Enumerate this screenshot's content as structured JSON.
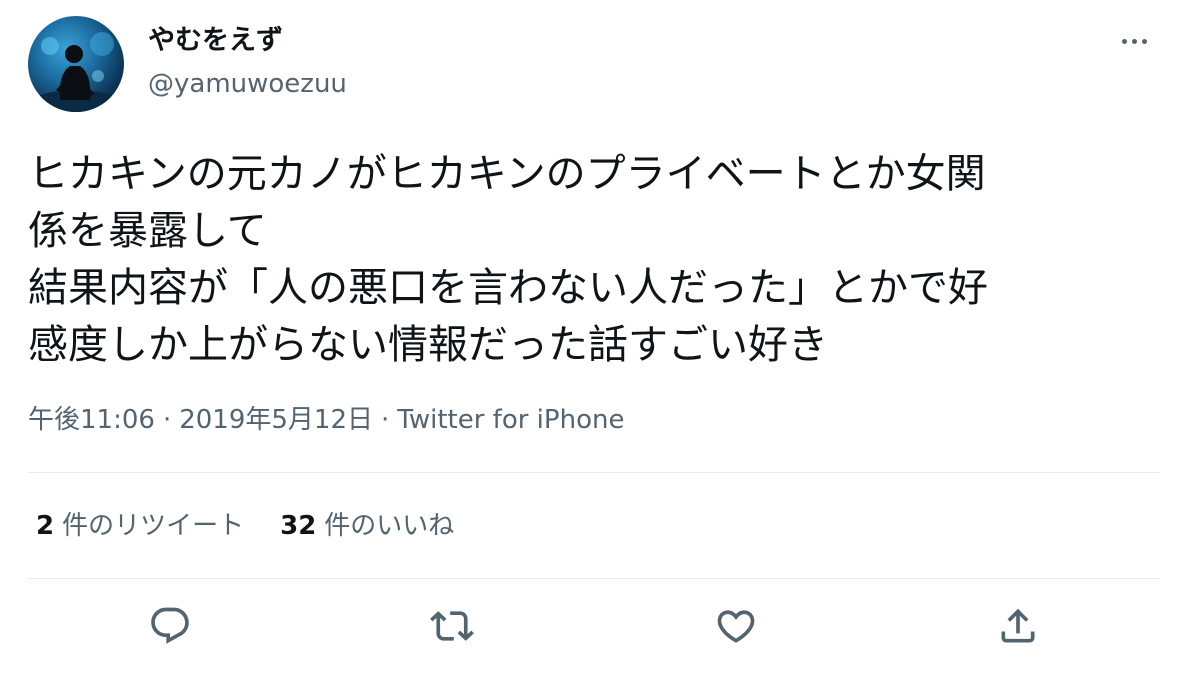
{
  "user": {
    "display_name": "やむをえず",
    "handle": "@yamuwoezuu",
    "avatar_icon": "profile-photo-aquarium"
  },
  "tweet": {
    "lines": [
      "ヒカキンの元カノがヒカキンのプライベートとか女関",
      "係を暴露して",
      "結果内容が「人の悪口を言わない人だった」とかで好",
      "感度しか上がらない情報だった話すごい好き"
    ]
  },
  "meta": {
    "time": "午後11:06",
    "date": "2019年5月12日",
    "source": "Twitter for iPhone",
    "separator": "·"
  },
  "stats": {
    "retweets": {
      "count": "2",
      "label": "件のリツイート"
    },
    "likes": {
      "count": "32",
      "label": "件のいいね"
    }
  },
  "actions": [
    {
      "name": "reply",
      "icon": "reply-icon"
    },
    {
      "name": "retweet",
      "icon": "retweet-icon"
    },
    {
      "name": "like",
      "icon": "heart-icon"
    },
    {
      "name": "share",
      "icon": "share-icon"
    }
  ],
  "colors": {
    "text": "#0f1419",
    "secondary": "#536471",
    "divider": "#e6ecf0"
  }
}
